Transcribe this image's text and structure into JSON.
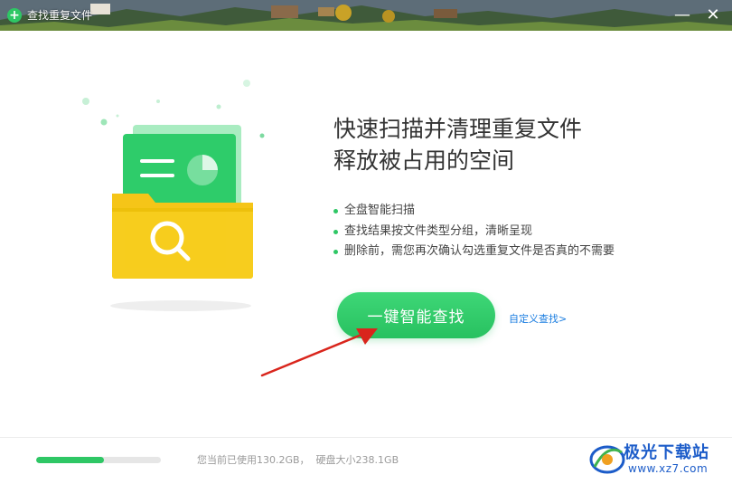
{
  "window": {
    "title": "查找重复文件"
  },
  "titlebar": {
    "min_icon": "minimize-icon",
    "close_icon": "close-icon",
    "min_glyph": "—",
    "close_glyph": "✕"
  },
  "headline": {
    "line1": "快速扫描并清理重复文件",
    "line2": "释放被占用的空间"
  },
  "features": [
    "全盘智能扫描",
    "查找结果按文件类型分组，清晰呈现",
    "删除前，需您再次确认勾选重复文件是否真的不需要"
  ],
  "actions": {
    "scan_button": "一键智能查找",
    "custom_link": "自定义查找>"
  },
  "disk": {
    "usage_text": "您当前已使用130.2GB，  硬盘大小238.1GB",
    "used_fraction": 0.547
  },
  "watermark": {
    "brand": "极光下载站",
    "url": "www.xz7.com"
  },
  "colors": {
    "accent": "#2ec765",
    "link": "#1a7de0",
    "arrow": "#d9251c",
    "folder": "#f5c518"
  }
}
